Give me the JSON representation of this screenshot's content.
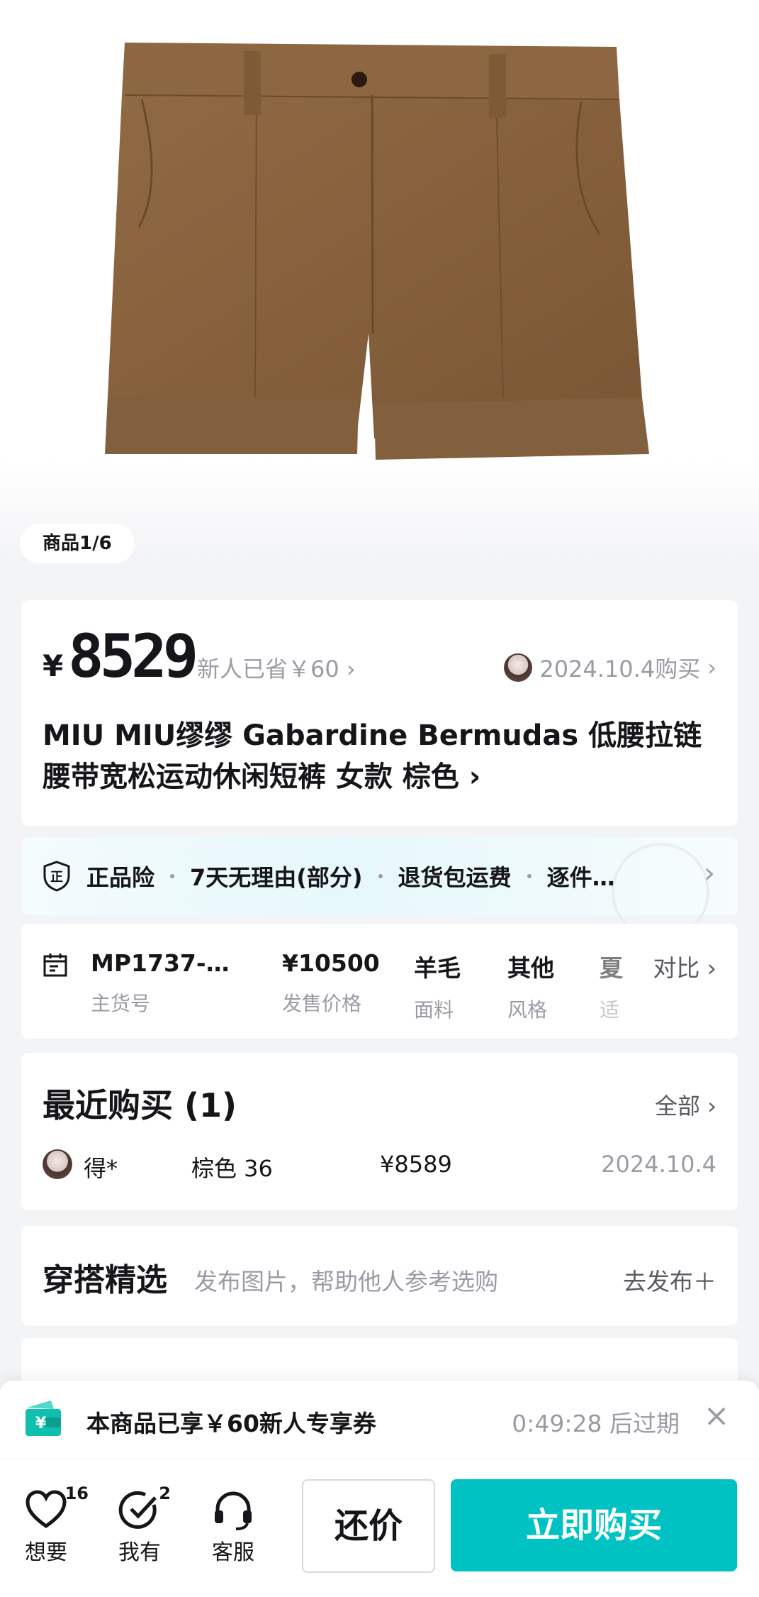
{
  "gallery": {
    "pager": "商品1/6"
  },
  "price": {
    "currency": "¥",
    "value": "8529",
    "saved": "新人已省￥60",
    "last_purchase": "2024.10.4购买",
    "title": "MIU MIU缪缪 Gabardine Bermudas 低腰拉链腰带宽松运动休闲短裤 女款 棕色"
  },
  "guarantees": [
    "正品险",
    "7天无理由(部分)",
    "退货包运费",
    "逐件…"
  ],
  "specs": [
    {
      "value": "MP1737-…",
      "label": "主货号"
    },
    {
      "value": "¥10500",
      "label": "发售价格"
    },
    {
      "value": "羊毛",
      "label": "面料"
    },
    {
      "value": "其他",
      "label": "风格"
    },
    {
      "value": "夏",
      "label": "适"
    }
  ],
  "compare": "对比",
  "recent": {
    "title": "最近购买 (1)",
    "all": "全部",
    "rows": [
      {
        "user": "得*",
        "spec": "棕色 36",
        "price": "¥8589",
        "date": "2024.10.4"
      }
    ]
  },
  "outfit": {
    "title": "穿搭精选",
    "subtitle": "发布图片，帮助他人参考选购",
    "post": "去发布"
  },
  "coupon": {
    "text": "本商品已享￥60新人专享券",
    "countdown": "0:49:28 后过期"
  },
  "bottom_bar": {
    "want": {
      "label": "想要",
      "count": "16"
    },
    "have": {
      "label": "我有",
      "count": "2"
    },
    "service": {
      "label": "客服"
    },
    "bargain": "还价",
    "buy": "立即购买"
  },
  "colors": {
    "accent": "#01c2c3",
    "muted": "#9b9ba5",
    "product": "#8a6440"
  }
}
